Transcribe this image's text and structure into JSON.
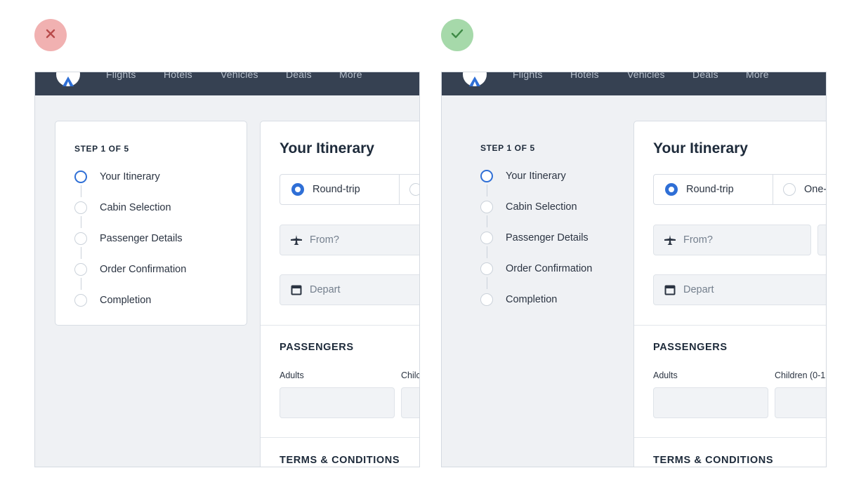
{
  "comparison": {
    "bad_badge_icon": "close-icon",
    "good_badge_icon": "check-icon",
    "bad_color": "#f1b1b1",
    "good_color": "#a6d9aa"
  },
  "nav": {
    "items": [
      "Flights",
      "Hotels",
      "Vehicles",
      "Deals",
      "More"
    ],
    "background": "#364152"
  },
  "steps": {
    "header": "STEP 1 OF 5",
    "items": [
      "Your Itinerary",
      "Cabin Selection",
      "Passenger Details",
      "Order Confirmation",
      "Completion"
    ],
    "active_index": 0,
    "accent": "#2f6fd6"
  },
  "itinerary": {
    "title": "Your Itinerary",
    "trip_types": [
      "Round-trip",
      "One-"
    ],
    "selected_trip": "Round-trip",
    "from_placeholder": "From?",
    "depart_placeholder": "Depart"
  },
  "passengers": {
    "title": "PASSENGERS",
    "adults_label": "Adults",
    "children_label_left": "Chilc",
    "children_label_right": "Children (0-1"
  },
  "terms": {
    "title": "TERMS & CONDITIONS"
  }
}
